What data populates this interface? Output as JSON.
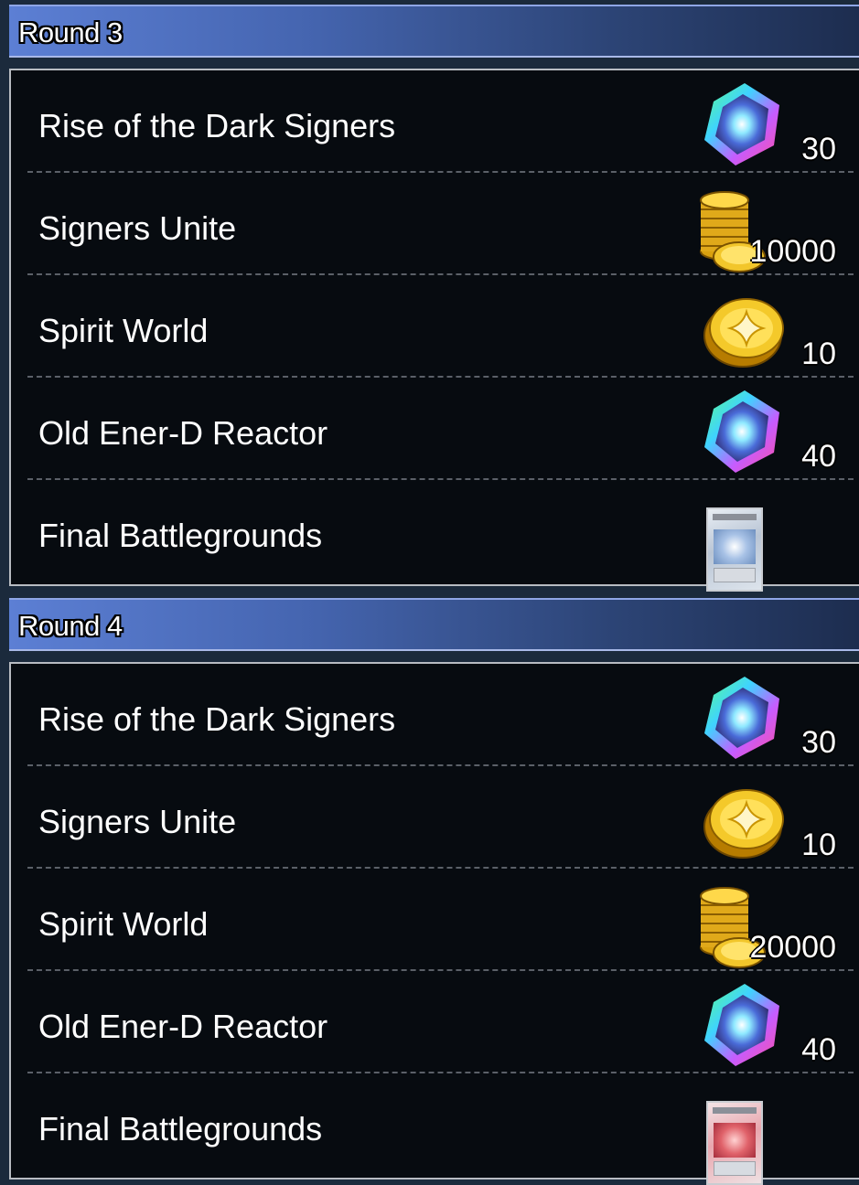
{
  "rounds": [
    {
      "title": "Round 3",
      "rows": [
        {
          "label": "Rise of the Dark Signers",
          "reward_icon": "gem-icon",
          "count": "30"
        },
        {
          "label": "Signers Unite",
          "reward_icon": "gold-stack-icon",
          "count": "10000"
        },
        {
          "label": "Spirit World",
          "reward_icon": "gold-coin-icon",
          "count": "10"
        },
        {
          "label": "Old Ener-D Reactor",
          "reward_icon": "gem-icon",
          "count": "40"
        },
        {
          "label": "Final Battlegrounds",
          "reward_icon": "card-white-icon",
          "count": ""
        }
      ]
    },
    {
      "title": "Round 4",
      "rows": [
        {
          "label": "Rise of the Dark Signers",
          "reward_icon": "gem-icon",
          "count": "30"
        },
        {
          "label": "Signers Unite",
          "reward_icon": "gold-coin-icon",
          "count": "10"
        },
        {
          "label": "Spirit World",
          "reward_icon": "gold-stack-icon",
          "count": "20000"
        },
        {
          "label": "Old Ener-D Reactor",
          "reward_icon": "gem-icon",
          "count": "40"
        },
        {
          "label": "Final Battlegrounds",
          "reward_icon": "card-red-icon",
          "count": ""
        }
      ]
    }
  ],
  "colors": {
    "header_light": "#5c7fd4",
    "header_dark": "#1d2d4f",
    "panel_bg": "#070b10",
    "divider": "#5b6068"
  }
}
